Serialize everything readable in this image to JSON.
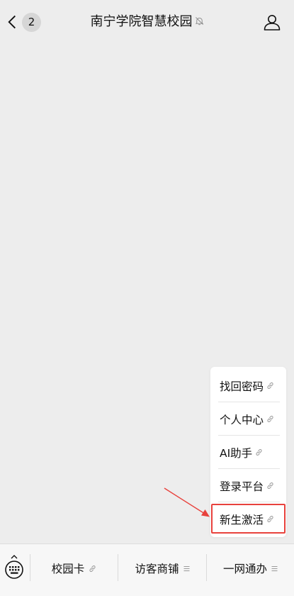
{
  "header": {
    "back_badge": "2",
    "title": "南宁学院智慧校园"
  },
  "popup": {
    "items": [
      {
        "label": "找回密码",
        "icon": "link-icon"
      },
      {
        "label": "个人中心",
        "icon": "link-icon"
      },
      {
        "label": "AI助手",
        "icon": "link-icon"
      },
      {
        "label": "登录平台",
        "icon": "link-icon"
      },
      {
        "label": "新生激活",
        "icon": "link-icon"
      }
    ]
  },
  "menubar": {
    "tabs": [
      {
        "label": "校园卡",
        "icon": "link-icon"
      },
      {
        "label": "访客商铺",
        "icon": "menu-lines-icon"
      },
      {
        "label": "一网通办",
        "icon": "menu-lines-icon"
      }
    ]
  },
  "colors": {
    "background": "#ededed",
    "highlight": "#e8423d",
    "menu_bg": "#f7f7f7",
    "popup_bg": "#ffffff"
  }
}
